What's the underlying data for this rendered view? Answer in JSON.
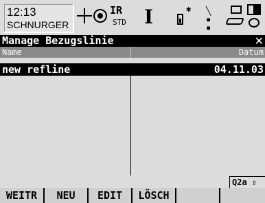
{
  "status": {
    "time": "12:13",
    "user": "SCHNURGER",
    "edm_mode": "IR",
    "edm_sub": "STD",
    "beam_symbol": "I",
    "icons": [
      "target-cross-icon",
      "prism-icon",
      "bluetooth-icon",
      "network-icon",
      "memory-card-icon",
      "battery-icon"
    ]
  },
  "title": {
    "text": "Manage Bezugslinie",
    "close": "✕"
  },
  "table": {
    "headers": [
      "Name",
      "Datum"
    ],
    "rows": [
      {
        "name": "new refline",
        "date": "04.11.03"
      }
    ]
  },
  "indicator": "Q2a ⇧",
  "fkeys": [
    {
      "label": "WEITR"
    },
    {
      "label": "NEU"
    },
    {
      "label": "EDIT"
    },
    {
      "label": "LÖSCH"
    },
    {
      "label": ""
    },
    {
      "label": ""
    }
  ]
}
